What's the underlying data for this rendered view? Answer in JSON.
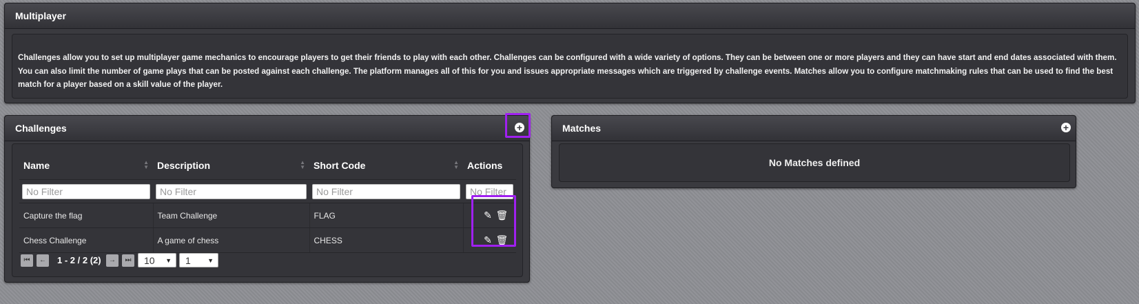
{
  "multiplayer": {
    "title": "Multiplayer",
    "description": "Challenges allow you to set up multiplayer game mechanics to encourage players to get their friends to play with each other. Challenges can be configured with a wide variety of options. They can be between one or more players and they can have start and end dates associated with them. You can also limit the number of game plays that can be posted against each challenge. The platform manages all of this for you and issues appropriate messages which are triggered by challenge events. Matches allow you to configure matchmaking rules that can be used to find the best match for a player based on a skill value of the player."
  },
  "challenges": {
    "title": "Challenges",
    "add_icon": "plus-circle-icon",
    "columns": [
      "Name",
      "Description",
      "Short Code",
      "Actions"
    ],
    "filter_placeholder": "No Filter",
    "rows": [
      {
        "name": "Capture the flag",
        "description": "Team Challenge",
        "short_code": "FLAG"
      },
      {
        "name": "Chess Challenge",
        "description": "A game of chess",
        "short_code": "CHESS"
      }
    ],
    "pager": {
      "range_text": "1 - 2 / 2 (2)",
      "page_size": "10",
      "page": "1"
    }
  },
  "matches": {
    "title": "Matches",
    "add_icon": "plus-circle-icon",
    "empty_message": "No Matches defined"
  },
  "colors": {
    "highlight": "#a020f0",
    "panel": "#3a3a3f"
  }
}
